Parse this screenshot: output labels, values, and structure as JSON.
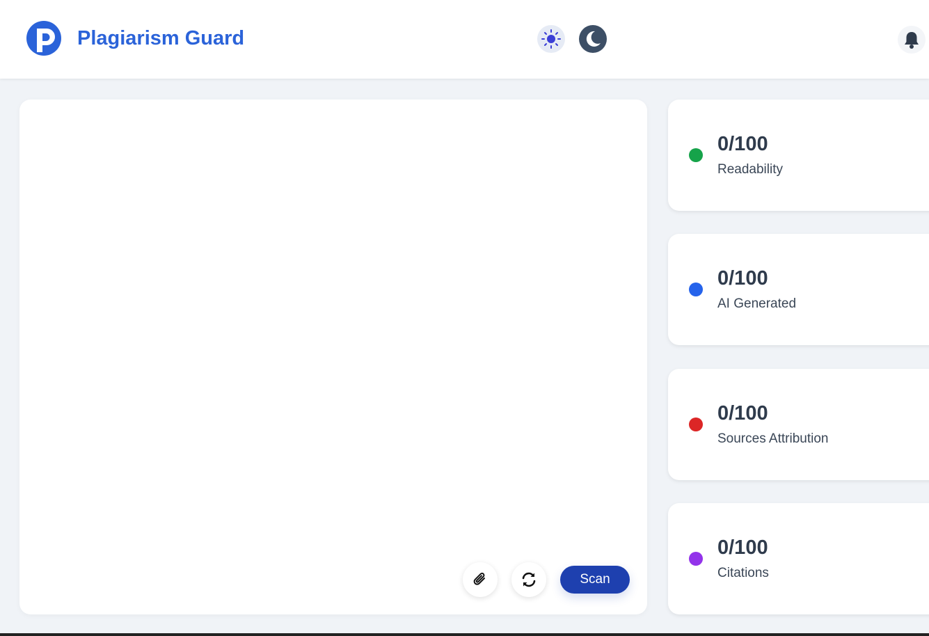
{
  "header": {
    "app_name": "Plagiarism Guard",
    "logo_icon": "p-logo-icon",
    "theme_light_icon": "sun-icon",
    "theme_dark_icon": "moon-icon",
    "notifications_icon": "bell-icon"
  },
  "editor": {
    "text": "",
    "attach_icon": "paperclip-icon",
    "reset_icon": "refresh-icon",
    "scan_label": "Scan"
  },
  "metrics": [
    {
      "score": "0/100",
      "label": "Readability",
      "color": "#16a34a"
    },
    {
      "score": "0/100",
      "label": "AI Generated",
      "color": "#2563eb"
    },
    {
      "score": "0/100",
      "label": "Sources Attribution",
      "color": "#dc2626"
    },
    {
      "score": "0/100",
      "label": "Citations",
      "color": "#9333ea"
    }
  ],
  "colors": {
    "brand": "#2b63d9",
    "scan_button": "#1e40af",
    "background": "#f0f3f7"
  }
}
